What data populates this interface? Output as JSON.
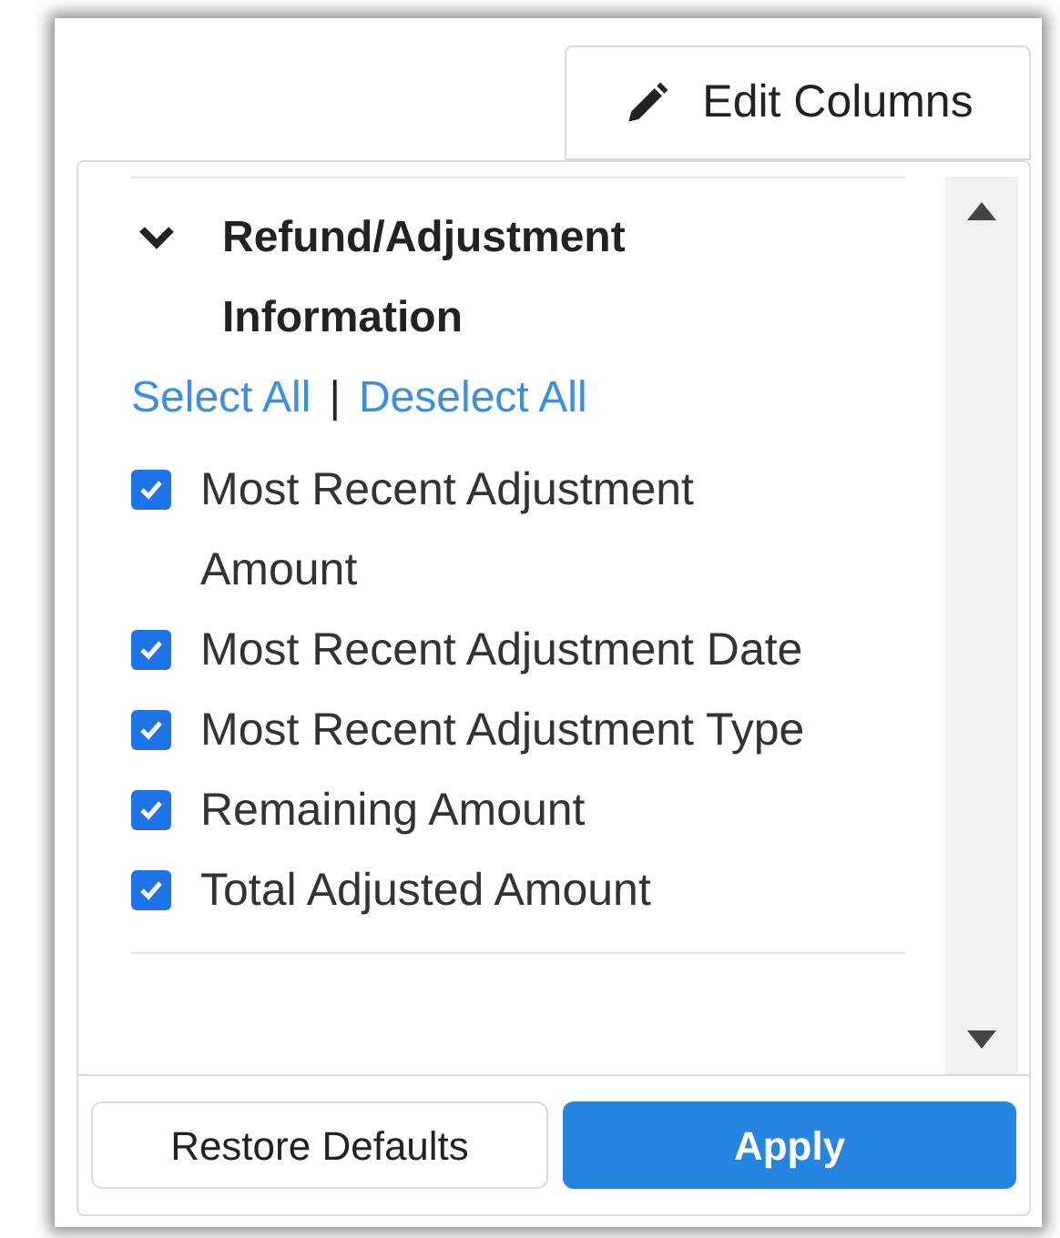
{
  "edit_button": {
    "label": "Edit Columns"
  },
  "section": {
    "title": "Refund/Adjustment Information",
    "expanded": true,
    "links": [
      "Select All",
      "Deselect All"
    ],
    "separator": "|",
    "items": [
      {
        "label": "Most Recent Adjustment Amount",
        "checked": true
      },
      {
        "label": "Most Recent Adjustment Date",
        "checked": true
      },
      {
        "label": "Most Recent Adjustment Type",
        "checked": true
      },
      {
        "label": "Remaining Amount",
        "checked": true
      },
      {
        "label": "Total Adjusted Amount",
        "checked": true
      }
    ]
  },
  "buttons": [
    {
      "label": "Restore Defaults",
      "kind": "secondary"
    },
    {
      "label": "Apply",
      "kind": "primary"
    }
  ]
}
